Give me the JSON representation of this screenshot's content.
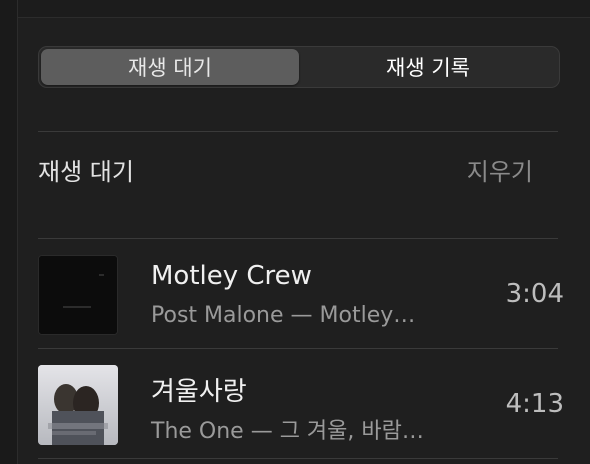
{
  "tabs": [
    {
      "label": "재생 대기",
      "active": true
    },
    {
      "label": "재생 기록",
      "active": false
    }
  ],
  "section": {
    "title": "재생 대기",
    "clear_label": "지우기"
  },
  "tracks": [
    {
      "title": "Motley Crew",
      "subtitle": "Post Malone — Motley…",
      "duration": "3:04",
      "art": "dark-album-art"
    },
    {
      "title": "겨울사랑",
      "subtitle": "The One — 그 겨울, 바람…",
      "duration": "4:13",
      "art": "photo-album-art"
    }
  ]
}
